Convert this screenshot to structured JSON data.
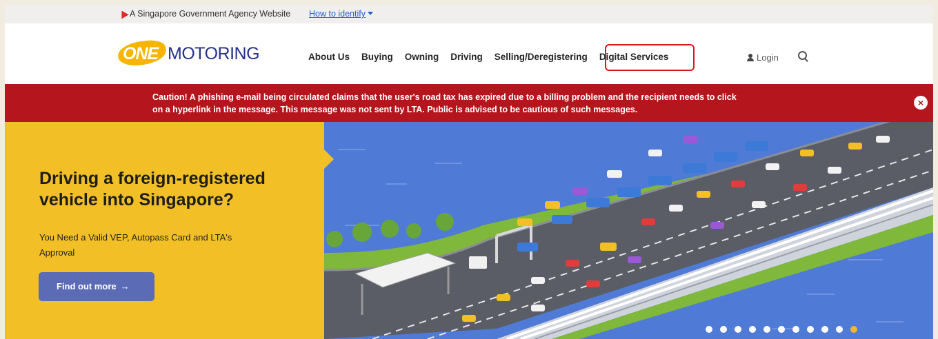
{
  "gov_strip": {
    "agency_text": "A Singapore Government Agency Website",
    "identify_link": "How to identify"
  },
  "header": {
    "logo_one": "ONE",
    "logo_motoring": "MOTORING",
    "nav": [
      "About Us",
      "Buying",
      "Owning",
      "Driving",
      "Selling/Deregistering",
      "Digital Services"
    ],
    "highlighted_nav": "Digital Services",
    "login_label": "Login",
    "highlight_color": "#e0141c"
  },
  "caution": {
    "line1": "Caution! A phishing e-mail being circulated claims that the user's road tax has expired due to a billing problem and the recipient needs to click",
    "line2": "on a hyperlink in the message. This message was not sent by LTA. Public is advised to be cautious of such messages.",
    "close_glyph": "×",
    "color": "#b5151c"
  },
  "hero": {
    "title": "Driving a foreign-registered vehicle into Singapore?",
    "subtitle": "You Need a Valid VEP, Autopass Card and LTA's Approval",
    "button_label": "Find out more",
    "button_arrow": "→",
    "panel_color": "#f2c026",
    "slide_count": 11,
    "active_slide": 11
  }
}
